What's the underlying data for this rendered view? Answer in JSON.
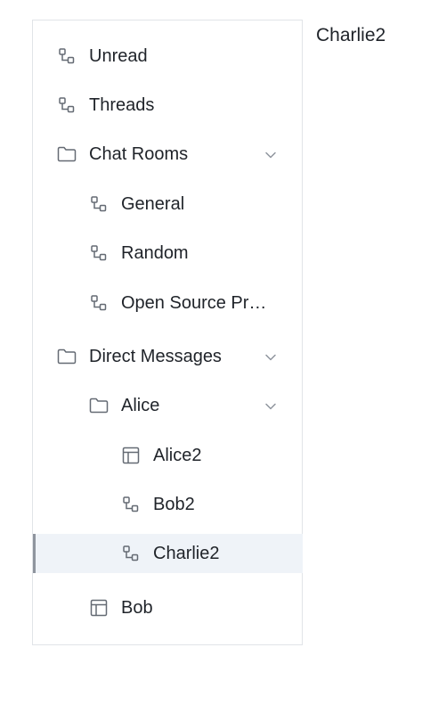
{
  "sidebar": {
    "items": [
      {
        "label": "Unread",
        "icon": "topic-icon"
      },
      {
        "label": "Threads",
        "icon": "topic-icon"
      },
      {
        "label": "Chat Rooms",
        "icon": "folder-icon"
      },
      {
        "label": "General",
        "icon": "topic-icon"
      },
      {
        "label": "Random",
        "icon": "topic-icon"
      },
      {
        "label": "Open Source Pr…",
        "icon": "topic-icon"
      },
      {
        "label": "Direct Messages",
        "icon": "folder-icon"
      },
      {
        "label": "Alice",
        "icon": "folder-icon"
      },
      {
        "label": "Alice2",
        "icon": "table-icon"
      },
      {
        "label": "Bob2",
        "icon": "topic-icon"
      },
      {
        "label": "Charlie2",
        "icon": "topic-icon"
      },
      {
        "label": "Bob",
        "icon": "table-icon"
      }
    ],
    "selected_item": "Charlie2"
  },
  "main": {
    "title": "Charlie2"
  },
  "colors": {
    "border": "#e1e4e8",
    "selected_background": "#eff3f8",
    "selected_indicator": "#8f959e",
    "icon": "#646a73",
    "text": "#1f2329"
  }
}
